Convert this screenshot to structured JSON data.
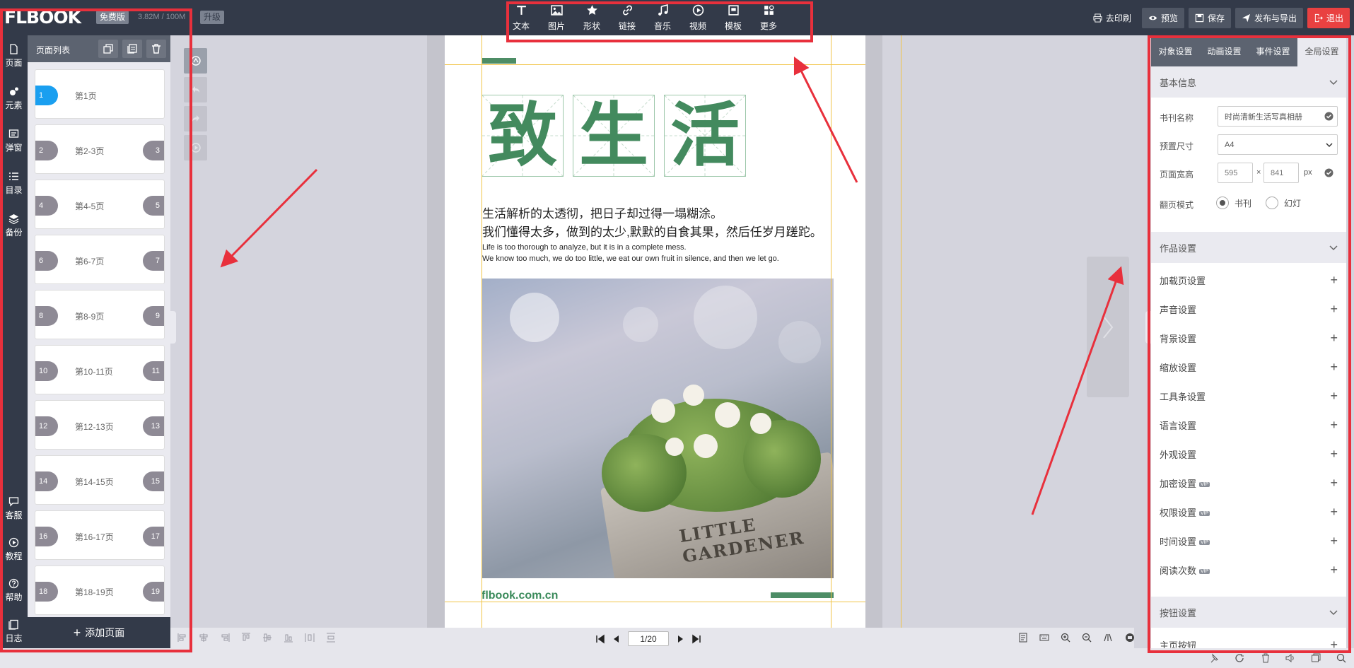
{
  "header": {
    "logo": "FLBOOK",
    "free_badge": "免费版",
    "usage": "3.82M / 100M",
    "upgrade_badge": "升级",
    "tools": [
      {
        "label": "文本",
        "icon": "text-icon"
      },
      {
        "label": "图片",
        "icon": "image-icon"
      },
      {
        "label": "形状",
        "icon": "star-icon"
      },
      {
        "label": "链接",
        "icon": "link-icon"
      },
      {
        "label": "音乐",
        "icon": "music-icon"
      },
      {
        "label": "视频",
        "icon": "video-icon"
      },
      {
        "label": "模板",
        "icon": "template-icon"
      },
      {
        "label": "更多",
        "icon": "more-icon"
      }
    ],
    "print_label": "去印刷",
    "preview_label": "预览",
    "save_label": "保存",
    "publish_label": "发布与导出",
    "exit_label": "退出"
  },
  "left_nav": {
    "top": [
      {
        "label": "页面",
        "icon": "page-icon"
      },
      {
        "label": "元素",
        "icon": "elements-icon"
      },
      {
        "label": "弹窗",
        "icon": "popup-icon"
      },
      {
        "label": "目录",
        "icon": "list-icon"
      },
      {
        "label": "备份",
        "icon": "layers-icon"
      }
    ],
    "bottom": [
      {
        "label": "客服",
        "icon": "chat-icon"
      },
      {
        "label": "教程",
        "icon": "play-icon"
      },
      {
        "label": "帮助",
        "icon": "help-icon"
      },
      {
        "label": "日志",
        "icon": "log-icon"
      }
    ]
  },
  "pages_panel": {
    "title": "页面列表",
    "add_label": "添加页面",
    "items": [
      {
        "label": "第1页",
        "left": "1",
        "right": ""
      },
      {
        "label": "第2-3页",
        "left": "2",
        "right": "3"
      },
      {
        "label": "第4-5页",
        "left": "4",
        "right": "5"
      },
      {
        "label": "第6-7页",
        "left": "6",
        "right": "7"
      },
      {
        "label": "第8-9页",
        "left": "8",
        "right": "9"
      },
      {
        "label": "第10-11页",
        "left": "10",
        "right": "11"
      },
      {
        "label": "第12-13页",
        "left": "12",
        "right": "13"
      },
      {
        "label": "第14-15页",
        "left": "14",
        "right": "15"
      },
      {
        "label": "第16-17页",
        "left": "16",
        "right": "17"
      },
      {
        "label": "第18-19页",
        "left": "18",
        "right": "19"
      }
    ]
  },
  "page_content": {
    "title_chars": [
      "致",
      "生",
      "活"
    ],
    "cn_line1": "生活解析的太透彻，把日子却过得一塌糊涂。",
    "cn_line2": "我们懂得太多，做到的太少,默默的自食其果，然后任岁月蹉跎。",
    "en_line1": "Life is too thorough to analyze, but it is in a complete mess.",
    "en_line2": "We know too much, we do too little, we eat our own fruit in silence, and then we let go.",
    "pot_text": "LITTLE GARDENER",
    "site": "flbook.com.cn"
  },
  "right_panel": {
    "tabs": [
      "对象设置",
      "动画设置",
      "事件设置",
      "全局设置"
    ],
    "active_tab": 3,
    "basic_section": "基本信息",
    "name_label": "书刊名称",
    "name_value": "时尚清新生活写真相册",
    "size_label": "预置尺寸",
    "size_value": "A4",
    "wh_label": "页面宽高",
    "width_value": "595",
    "height_value": "841",
    "times": "×",
    "unit": "px",
    "mode_label": "翻页模式",
    "mode_book": "书刊",
    "mode_slide": "幻灯",
    "works_section": "作品设置",
    "settings": [
      {
        "label": "加载页设置",
        "vip": ""
      },
      {
        "label": "声音设置",
        "vip": ""
      },
      {
        "label": "背景设置",
        "vip": ""
      },
      {
        "label": "缩放设置",
        "vip": ""
      },
      {
        "label": "工具条设置",
        "vip": ""
      },
      {
        "label": "语言设置",
        "vip": ""
      },
      {
        "label": "外观设置",
        "vip": ""
      },
      {
        "label": "加密设置",
        "vip": "VIP"
      },
      {
        "label": "权限设置",
        "vip": "VIP"
      },
      {
        "label": "时间设置",
        "vip": "VIP"
      },
      {
        "label": "阅读次数",
        "vip": "VIP"
      }
    ],
    "button_section": "按钮设置",
    "home_button": "主页按钮"
  },
  "pager": {
    "value": "1/20"
  },
  "colors": {
    "highlight": "#e8303c",
    "accent_green": "#438a5e",
    "topbar": "#333a49"
  }
}
